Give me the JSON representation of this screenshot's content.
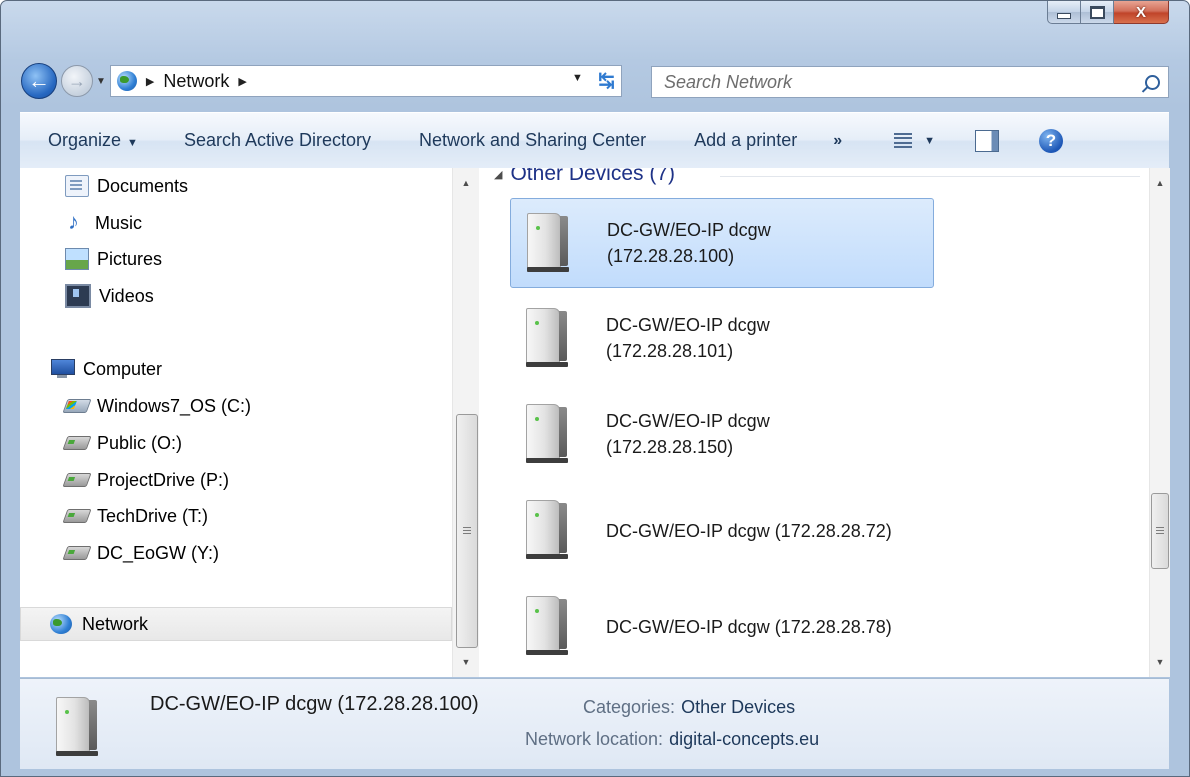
{
  "window": {
    "buttons": {
      "minimize": "minimize",
      "maximize": "maximize",
      "close": "X"
    }
  },
  "address": {
    "crumbs": [
      "Network"
    ],
    "search_placeholder": "Search Network"
  },
  "toolbar": {
    "organize": "Organize",
    "search_ad": "Search Active Directory",
    "network_sharing": "Network and Sharing Center",
    "add_printer": "Add a printer",
    "more": "»"
  },
  "nav_pane": {
    "libraries": [
      "Documents",
      "Music",
      "Pictures",
      "Videos"
    ],
    "computer": "Computer",
    "drives": [
      "Windows7_OS (C:)",
      "Public (O:)",
      "ProjectDrive (P:)",
      "TechDrive (T:)",
      "DC_EoGW (Y:)"
    ],
    "network": "Network"
  },
  "group": {
    "title": "Other Devices (7)"
  },
  "devices": [
    {
      "line1": "DC-GW/EO-IP dcgw",
      "line2": "(172.28.28.100)",
      "selected": true
    },
    {
      "line1": "DC-GW/EO-IP dcgw",
      "line2": "(172.28.28.101)",
      "selected": false
    },
    {
      "line1": "DC-GW/EO-IP dcgw",
      "line2": "(172.28.28.150)",
      "selected": false
    },
    {
      "line1": "DC-GW/EO-IP dcgw (172.28.28.72)",
      "line2": "",
      "selected": false
    },
    {
      "line1": "DC-GW/EO-IP dcgw (172.28.28.78)",
      "line2": "",
      "selected": false
    }
  ],
  "details": {
    "name": "DC-GW/EO-IP dcgw (172.28.28.100)",
    "categories_label": "Categories:",
    "categories_value": "Other Devices",
    "location_label": "Network location:",
    "location_value": "digital-concepts.eu"
  },
  "colors": {
    "selection": "#c1dcfc",
    "group_title": "#1e3287",
    "toolbar_text": "#1e395b"
  },
  "icons": [
    "back-arrow-icon",
    "forward-arrow-icon",
    "network-globe-icon",
    "refresh-icon",
    "search-icon",
    "view-options-icon",
    "preview-pane-icon",
    "help-icon",
    "device-icon"
  ]
}
